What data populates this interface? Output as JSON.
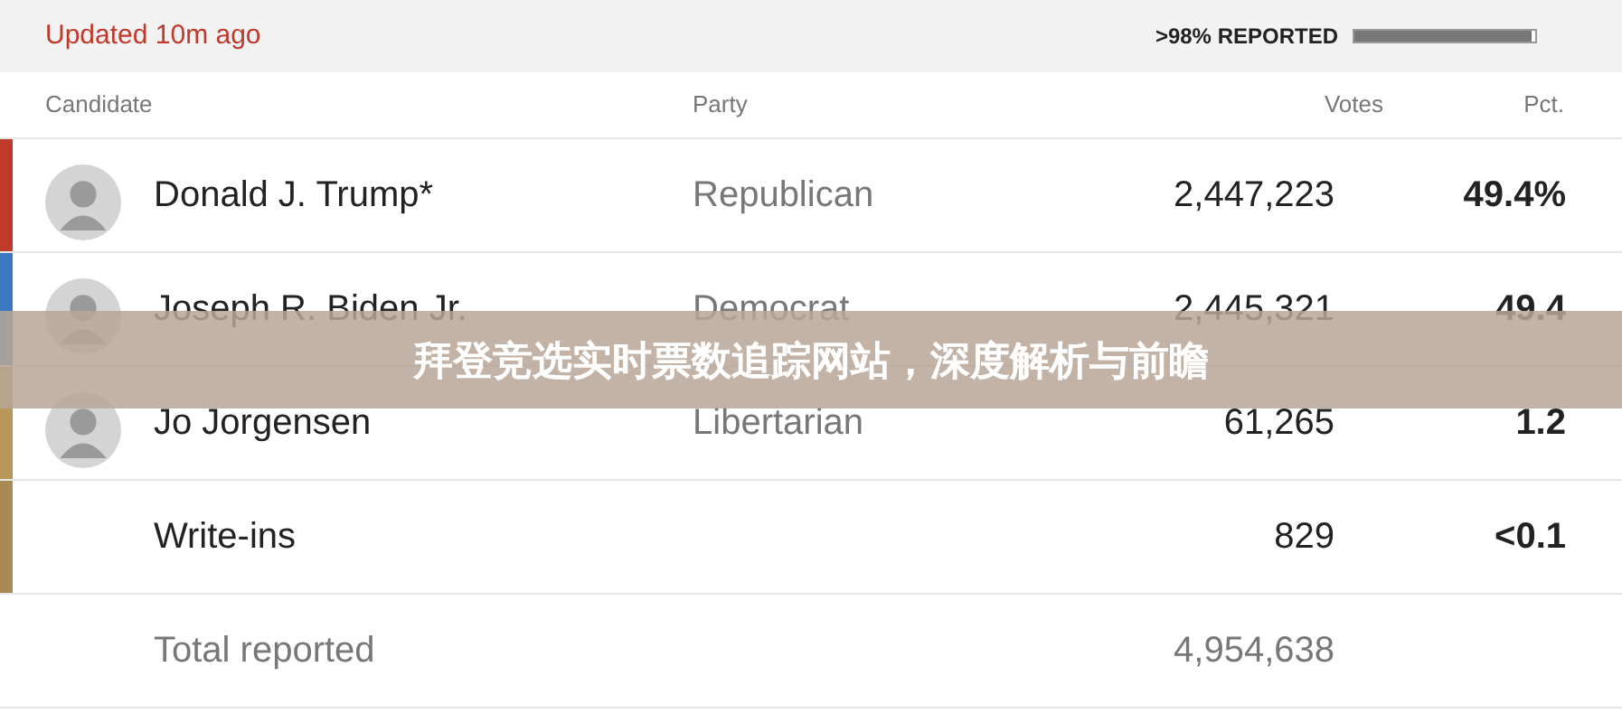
{
  "header": {
    "updated": "Updated 10m ago",
    "reported": ">98% REPORTED",
    "level": 0.98
  },
  "table": {
    "columns": [
      "Candidate",
      "Party",
      "Votes",
      "Pct."
    ],
    "rows": [
      {
        "kind": "candidate",
        "name": "Donald J. Trump*",
        "party": "Republican",
        "votes": "2,447,223",
        "pct": "49.4%",
        "color": "#c0392b"
      },
      {
        "kind": "candidate",
        "name": "Joseph R. Biden Jr.",
        "party": "Democrat",
        "votes": "2,445,321",
        "pct": "49.4",
        "color": "#3b78c2"
      },
      {
        "kind": "candidate",
        "name": "Jo Jorgensen",
        "party": "Libertarian",
        "votes": "61,265",
        "pct": "1.2",
        "color": "#b8975a"
      },
      {
        "kind": "other",
        "name": "Write-ins",
        "votes": "829",
        "pct": "<0.1",
        "color": "#a88a55"
      },
      {
        "kind": "total",
        "name": "Total reported",
        "votes": "4,954,638"
      }
    ]
  },
  "banner": {
    "title": "拜登竞选实时票数追踪网站，深度解析与前瞻"
  }
}
